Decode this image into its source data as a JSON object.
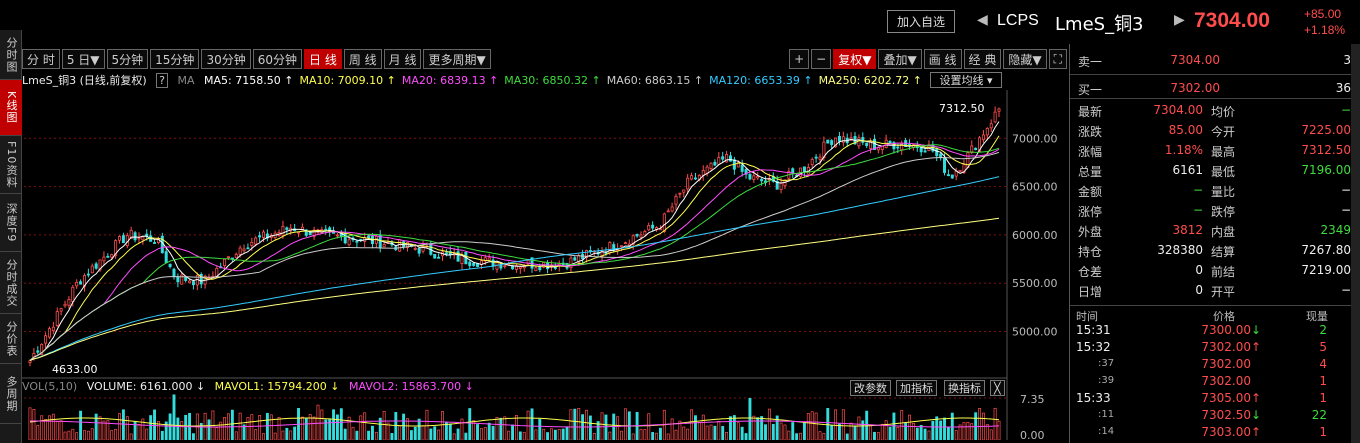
{
  "left_tabs": [
    "分时图",
    "K线图",
    "F10资料",
    "深度F9",
    "分时成交",
    "分价表",
    "多周期"
  ],
  "header": {
    "add_watch": "加入自选",
    "code": "LCPS",
    "name": "LmeS_铜3",
    "price": "7304.00",
    "change": "+85.00",
    "change_pct": "+1.18%",
    "nav_left": "◀",
    "nav_right": "▶"
  },
  "periods": [
    "分 时",
    "5 日▼",
    "5分钟",
    "15分钟",
    "30分钟",
    "60分钟",
    "日 线",
    "周 线",
    "月 线",
    "更多周期▼"
  ],
  "active_period": "日 线",
  "tools": [
    "+",
    "−",
    "复权▼",
    "叠加▼",
    "画 线",
    "经 典",
    "隐藏▼",
    "⛶"
  ],
  "ma_bar": {
    "title": "LmeS_铜3 (日线,前复权)",
    "q": "?",
    "ma_label": "MA",
    "items": [
      {
        "text": "MA5: 7158.50 ↑",
        "color": "#ffffff"
      },
      {
        "text": "MA10: 7009.10 ↑",
        "color": "#ffff4d"
      },
      {
        "text": "MA20: 6839.13 ↑",
        "color": "#ff4dff"
      },
      {
        "text": "MA30: 6850.32 ↑",
        "color": "#3fdc3f"
      },
      {
        "text": "MA60: 6863.15 ↑",
        "color": "#cccccc"
      },
      {
        "text": "MA120: 6653.39 ↑",
        "color": "#33ccff"
      },
      {
        "text": "MA250: 6202.72 ↑",
        "color": "#ffff80"
      }
    ],
    "set_ma": "设置均线 ▾"
  },
  "chart_data": {
    "type": "candlestick",
    "y_ticks": [
      "7000.00",
      "6500.00",
      "6000.00",
      "5500.00",
      "5000.00"
    ],
    "y_tick_values": [
      7000,
      6500,
      6000,
      5500,
      5000
    ],
    "high_label": "7312.50",
    "low_label": "4633.00",
    "trend": [
      [
        0,
        4700
      ],
      [
        0.05,
        5520
      ],
      [
        0.1,
        6000
      ],
      [
        0.13,
        5950
      ],
      [
        0.15,
        5560
      ],
      [
        0.18,
        5520
      ],
      [
        0.22,
        5900
      ],
      [
        0.27,
        6080
      ],
      [
        0.3,
        6000
      ],
      [
        0.34,
        5960
      ],
      [
        0.4,
        5860
      ],
      [
        0.45,
        5740
      ],
      [
        0.5,
        5700
      ],
      [
        0.55,
        5700
      ],
      [
        0.6,
        5880
      ],
      [
        0.65,
        6100
      ],
      [
        0.68,
        6550
      ],
      [
        0.72,
        6800
      ],
      [
        0.74,
        6600
      ],
      [
        0.77,
        6520
      ],
      [
        0.8,
        6700
      ],
      [
        0.83,
        7020
      ],
      [
        0.87,
        6920
      ],
      [
        0.9,
        6950
      ],
      [
        0.93,
        6900
      ],
      [
        0.95,
        6600
      ],
      [
        0.97,
        6850
      ],
      [
        1,
        7304
      ]
    ],
    "ma_colors": [
      "#ffffff",
      "#ffff4d",
      "#ff4dff",
      "#3fdc3f",
      "#cccccc",
      "#33ccff",
      "#ffff80"
    ],
    "volume": {
      "label": "VOL(5,10)",
      "vol": "VOLUME: 6161.000 ↓",
      "mavol1": "MAVOL1: 15794.200 ↓",
      "mavol2": "MAVOL2: 15863.700 ↓",
      "ticks": [
        "7.35",
        "0.00"
      ]
    }
  },
  "vol_buttons": [
    "改参数",
    "加指标",
    "换指标",
    "╳"
  ],
  "quote": {
    "ask": {
      "label": "卖一",
      "price": "7304.00",
      "qty": "3"
    },
    "bid": {
      "label": "买一",
      "price": "7302.00",
      "qty": "36"
    },
    "rows": [
      {
        "k1": "最新",
        "v1": "7304.00",
        "c1": "red",
        "k2": "均价",
        "v2": "−",
        "c2": "green"
      },
      {
        "k1": "涨跌",
        "v1": "85.00",
        "c1": "red",
        "k2": "今开",
        "v2": "7225.00",
        "c2": "red"
      },
      {
        "k1": "涨幅",
        "v1": "1.18%",
        "c1": "red",
        "k2": "最高",
        "v2": "7312.50",
        "c2": "red"
      },
      {
        "k1": "总量",
        "v1": "6161",
        "c1": "white",
        "k2": "最低",
        "v2": "7196.00",
        "c2": "green"
      },
      {
        "k1": "金额",
        "v1": "−",
        "c1": "green",
        "k2": "量比",
        "v2": "−",
        "c2": "white"
      },
      {
        "k1": "涨停",
        "v1": "−",
        "c1": "green",
        "k2": "跌停",
        "v2": "−",
        "c2": "white"
      },
      {
        "k1": "外盘",
        "v1": "3812",
        "c1": "red",
        "k2": "内盘",
        "v2": "2349",
        "c2": "green"
      },
      {
        "k1": "持仓",
        "v1": "328380",
        "c1": "white",
        "k2": "结算",
        "v2": "7267.80",
        "c2": "white"
      },
      {
        "k1": "仓差",
        "v1": "0",
        "c1": "white",
        "k2": "前结",
        "v2": "7219.00",
        "c2": "white"
      },
      {
        "k1": "日增",
        "v1": "0",
        "c1": "white",
        "k2": "开平",
        "v2": "−",
        "c2": "white"
      }
    ]
  },
  "trades_header": {
    "time": "时间",
    "price": "价格",
    "qty": "现量"
  },
  "trades": [
    {
      "time": "15:31",
      "main": true,
      "price": "7300.00",
      "arrow": "↓",
      "qty": "2",
      "pc": "red",
      "ac": "green",
      "qc": "green"
    },
    {
      "time": "15:32",
      "main": true,
      "price": "7302.00",
      "arrow": "↑",
      "qty": "5",
      "pc": "red",
      "ac": "red",
      "qc": "red"
    },
    {
      "time": ":37",
      "main": false,
      "price": "7302.00",
      "arrow": "",
      "qty": "4",
      "pc": "red",
      "ac": "red",
      "qc": "red"
    },
    {
      "time": ":39",
      "main": false,
      "price": "7302.00",
      "arrow": "",
      "qty": "1",
      "pc": "red",
      "ac": "red",
      "qc": "red"
    },
    {
      "time": "15:33",
      "main": true,
      "price": "7305.00",
      "arrow": "↑",
      "qty": "1",
      "pc": "red",
      "ac": "red",
      "qc": "red"
    },
    {
      "time": ":11",
      "main": false,
      "price": "7302.50",
      "arrow": "↓",
      "qty": "22",
      "pc": "red",
      "ac": "green",
      "qc": "green"
    },
    {
      "time": ":14",
      "main": false,
      "price": "7303.00",
      "arrow": "↑",
      "qty": "1",
      "pc": "red",
      "ac": "red",
      "qc": "red"
    }
  ]
}
